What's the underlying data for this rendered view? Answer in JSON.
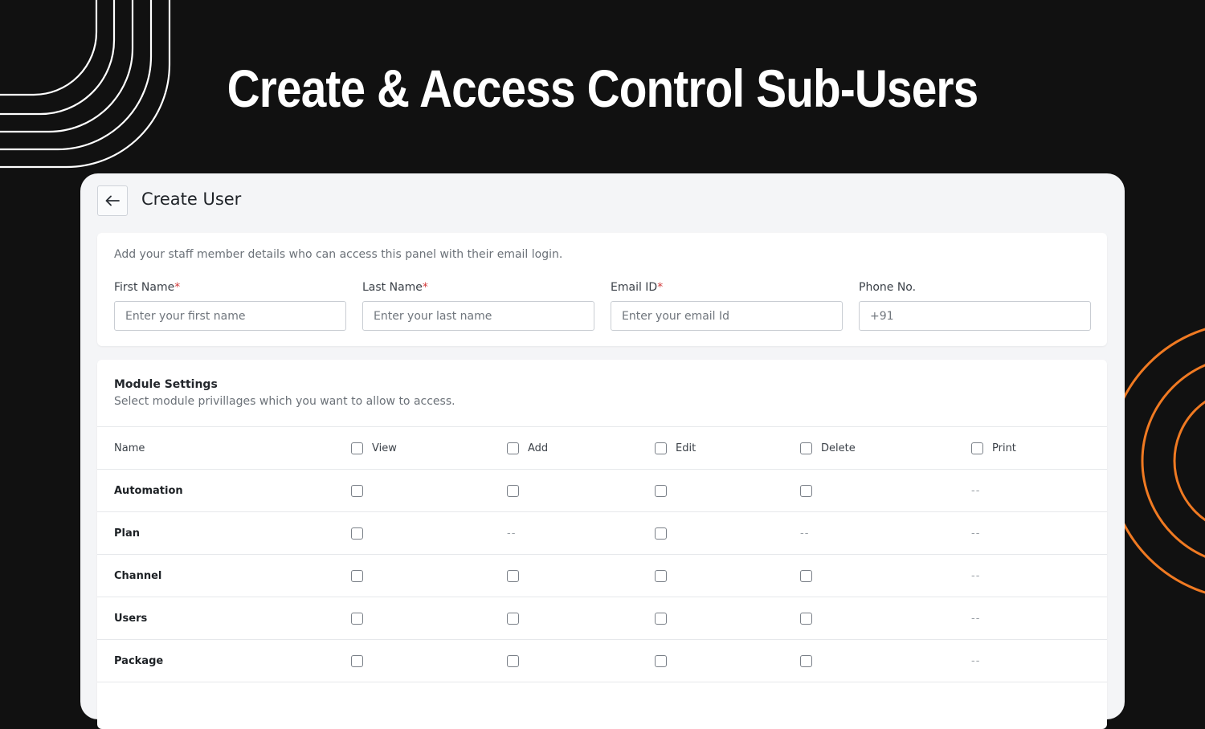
{
  "hero": {
    "title": "Create & Access Control Sub-Users"
  },
  "header": {
    "title": "Create User",
    "back_icon": "arrow-left-icon"
  },
  "details": {
    "intro": "Add your staff member details who can access this panel with their email login.",
    "fields": [
      {
        "label": "First Name",
        "required": true,
        "placeholder": "Enter your first name",
        "value": ""
      },
      {
        "label": "Last Name",
        "required": true,
        "placeholder": "Enter your last name",
        "value": ""
      },
      {
        "label": "Email ID",
        "required": true,
        "placeholder": "Enter your email Id",
        "value": ""
      },
      {
        "label": "Phone No.",
        "required": false,
        "placeholder": "+91",
        "value": ""
      }
    ],
    "required_mark": "*"
  },
  "module_settings": {
    "title": "Module Settings",
    "subtitle": "Select module privillages which you want to allow to access.",
    "columns": [
      "Name",
      "View",
      "Add",
      "Edit",
      "Delete",
      "Print"
    ],
    "rows": [
      {
        "name": "Automation",
        "view": "checkbox",
        "add": "checkbox",
        "edit": "checkbox",
        "delete": "checkbox",
        "print": "--"
      },
      {
        "name": "Plan",
        "view": "checkbox",
        "add": "--",
        "edit": "checkbox",
        "delete": "--",
        "print": "--"
      },
      {
        "name": "Channel",
        "view": "checkbox",
        "add": "checkbox",
        "edit": "checkbox",
        "delete": "checkbox",
        "print": "--"
      },
      {
        "name": "Users",
        "view": "checkbox",
        "add": "checkbox",
        "edit": "checkbox",
        "delete": "checkbox",
        "print": "--"
      },
      {
        "name": "Package",
        "view": "checkbox",
        "add": "checkbox",
        "edit": "checkbox",
        "delete": "checkbox",
        "print": "--"
      }
    ]
  },
  "colors": {
    "background": "#111111",
    "panel": "#f4f5f7",
    "accent_orange": "#f07a22",
    "required": "#d23a3a"
  }
}
